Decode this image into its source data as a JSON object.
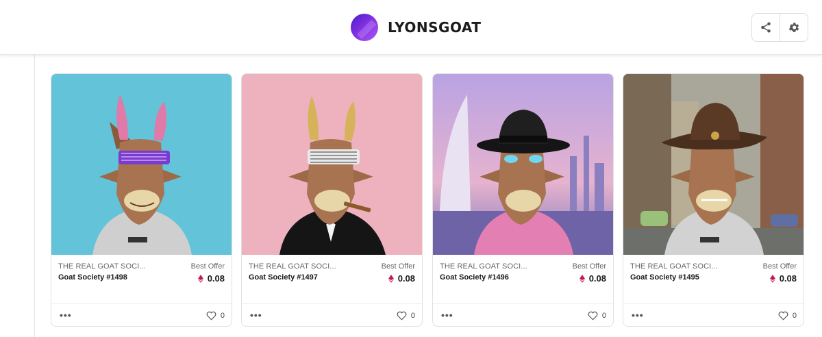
{
  "header": {
    "title": "LYONSGOAT",
    "avatar_icon": "gradient-avatar",
    "accent": "#7b2fe0",
    "actions": [
      {
        "icon": "share-icon"
      },
      {
        "icon": "gear-icon"
      }
    ]
  },
  "cards": [
    {
      "collection": "THE REAL GOAT SOCI...",
      "name": "Goat Society #1498",
      "offer_label": "Best Offer",
      "price": "0.08",
      "currency_icon": "eth-icon",
      "likes": "0",
      "background": "#62c3d9",
      "art": "goat with pink horns, purple shutter shades, grey t-shirt"
    },
    {
      "collection": "THE REAL GOAT SOCI...",
      "name": "Goat Society #1497",
      "offer_label": "Best Offer",
      "price": "0.08",
      "currency_icon": "eth-icon",
      "likes": "0",
      "background": "#eeb1be",
      "art": "goat with gold horns, white shutter shades, tuxedo, cigar"
    },
    {
      "collection": "THE REAL GOAT SOCI...",
      "name": "Goat Society #1496",
      "offer_label": "Best Offer",
      "price": "0.08",
      "currency_icon": "eth-icon",
      "likes": "0",
      "background": "#c9b3e6",
      "art": "goat with black fedora, glowing eyes, pink hoodie, city skyline"
    },
    {
      "collection": "THE REAL GOAT SOCI...",
      "name": "Goat Society #1495",
      "offer_label": "Best Offer",
      "price": "0.08",
      "currency_icon": "eth-icon",
      "likes": "0",
      "background": "#8a8f86",
      "art": "goat with brown cowboy hat, grey t-shirt, city street"
    }
  ]
}
